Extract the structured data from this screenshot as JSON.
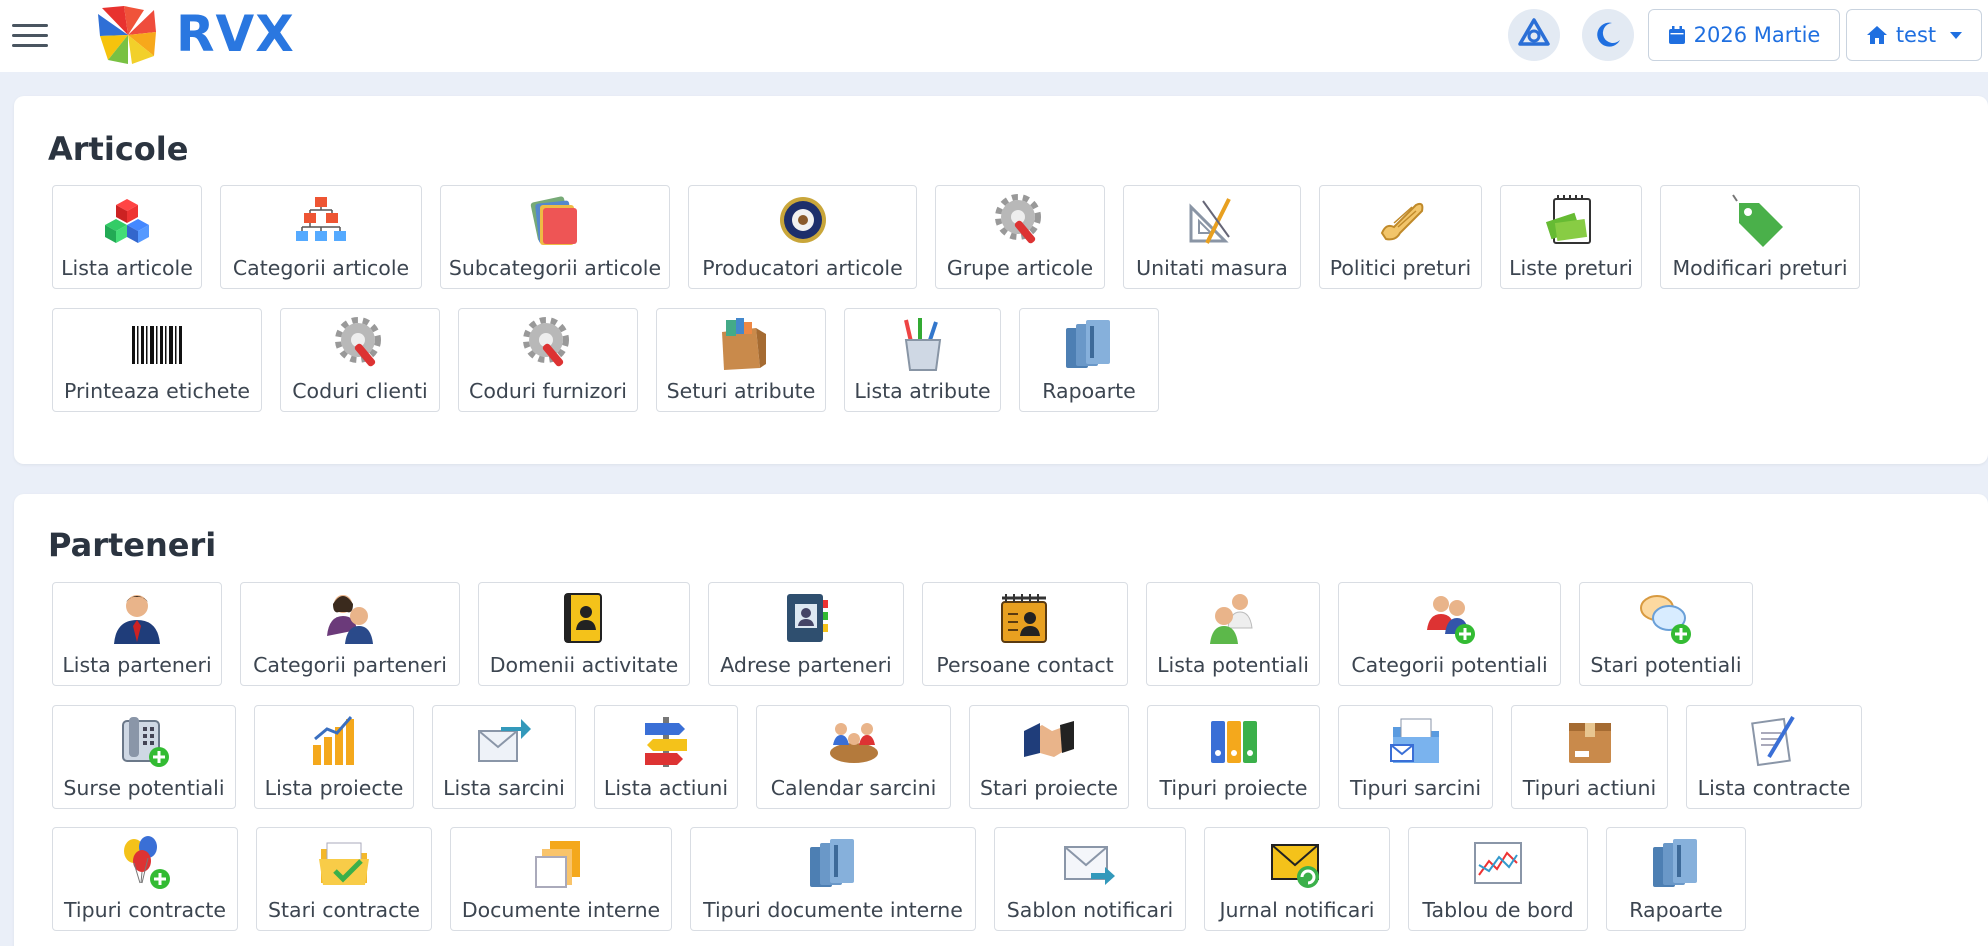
{
  "header": {
    "brand": "RVX",
    "date_label": "2026 Martie",
    "user_label": "test"
  },
  "sections": [
    {
      "title": "Articole",
      "rows": [
        [
          {
            "label": "Lista articole",
            "icon": "cubes-icon"
          },
          {
            "label": "Categorii articole",
            "icon": "hierarchy-icon"
          },
          {
            "label": "Subcategorii articole",
            "icon": "folders-icon"
          },
          {
            "label": "Producatori articole",
            "icon": "seal-icon"
          },
          {
            "label": "Grupe articole",
            "icon": "gear-wrench-icon"
          },
          {
            "label": "Unitati masura",
            "icon": "drafting-tools-icon"
          },
          {
            "label": "Politici preturi",
            "icon": "scroll-icon"
          },
          {
            "label": "Liste preturi",
            "icon": "money-notepad-icon"
          },
          {
            "label": "Modificari preturi",
            "icon": "price-tag-icon"
          }
        ],
        [
          {
            "label": "Printeaza etichete",
            "icon": "barcode-icon"
          },
          {
            "label": "Coduri clienti",
            "icon": "gear-wrench-icon"
          },
          {
            "label": "Coduri furnizori",
            "icon": "gear-wrench-icon"
          },
          {
            "label": "Seturi atribute",
            "icon": "paper-bag-icon"
          },
          {
            "label": "Lista atribute",
            "icon": "pencil-cup-icon"
          },
          {
            "label": "Rapoarte",
            "icon": "binders-icon"
          }
        ]
      ]
    },
    {
      "title": "Parteneri",
      "rows": [
        [
          {
            "label": "Lista parteneri",
            "icon": "businessman-icon"
          },
          {
            "label": "Categorii parteneri",
            "icon": "people-icon"
          },
          {
            "label": "Domenii activitate",
            "icon": "address-book-icon"
          },
          {
            "label": "Adrese parteneri",
            "icon": "contact-book-icon"
          },
          {
            "label": "Persoane contact",
            "icon": "rolodex-icon"
          },
          {
            "label": "Lista potentiali",
            "icon": "users-icon"
          },
          {
            "label": "Categorii potentiali",
            "icon": "user-add-icon"
          },
          {
            "label": "Stari potentiali",
            "icon": "chat-add-icon"
          }
        ],
        [
          {
            "label": "Surse potentiali",
            "icon": "phone-add-icon"
          },
          {
            "label": "Lista proiecte",
            "icon": "bar-chart-icon"
          },
          {
            "label": "Lista sarcini",
            "icon": "envelope-arrow-icon"
          },
          {
            "label": "Lista actiuni",
            "icon": "signpost-icon"
          },
          {
            "label": "Calendar sarcini",
            "icon": "meeting-icon"
          },
          {
            "label": "Stari proiecte",
            "icon": "handshake-icon"
          },
          {
            "label": "Tipuri proiecte",
            "icon": "binders-color-icon"
          },
          {
            "label": "Tipuri sarcini",
            "icon": "folder-mail-icon"
          },
          {
            "label": "Tipuri actiuni",
            "icon": "box-icon"
          },
          {
            "label": "Lista contracte",
            "icon": "document-pen-icon"
          }
        ],
        [
          {
            "label": "Tipuri contracte",
            "icon": "balloons-add-icon"
          },
          {
            "label": "Stari contracte",
            "icon": "folder-check-icon"
          },
          {
            "label": "Documente interne",
            "icon": "documents-icon"
          },
          {
            "label": "Tipuri documente interne",
            "icon": "binders-icon"
          },
          {
            "label": "Sablon notificari",
            "icon": "envelope-send-icon"
          },
          {
            "label": "Jurnal notificari",
            "icon": "envelope-refresh-icon"
          },
          {
            "label": "Tablou de bord",
            "icon": "line-chart-icon"
          },
          {
            "label": "Rapoarte",
            "icon": "binders-icon"
          }
        ]
      ]
    }
  ]
}
